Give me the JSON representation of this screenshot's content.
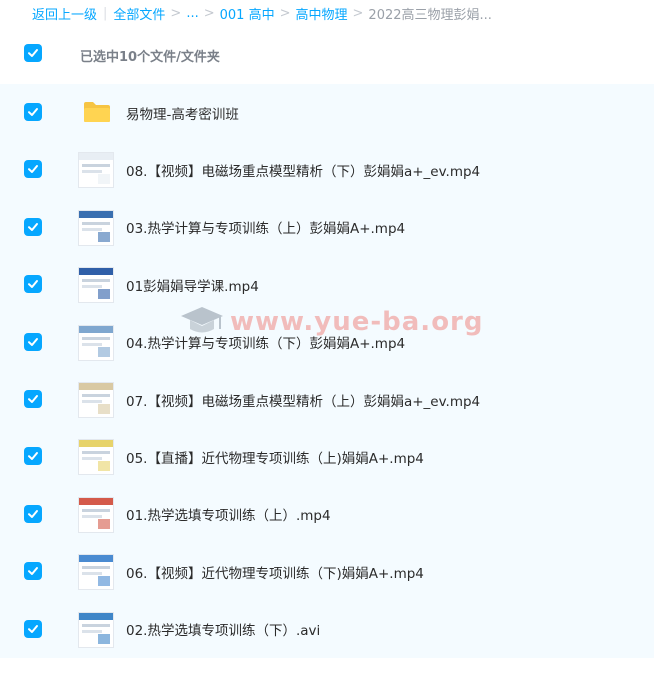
{
  "breadcrumb": {
    "back": "返回上一级",
    "items": [
      "全部文件",
      "...",
      "001 高中",
      "高中物理",
      "2022高三物理彭娟..."
    ]
  },
  "selection": {
    "label": "已选中10个文件/文件夹"
  },
  "files": [
    {
      "name": "易物理-高考密训班",
      "icon": "folder-icon",
      "accent": "#f6c443"
    },
    {
      "name": "08.【视频】电磁场重点模型精析（下）彭娟娟a+_ev.mp4",
      "icon": "video-thumbnail",
      "accent": "#e8eef4"
    },
    {
      "name": "03.热学计算与专项训练（上）彭娟娟A+.mp4",
      "icon": "video-thumbnail",
      "accent": "#3a6fb0"
    },
    {
      "name": "01彭娟娟导学课.mp4",
      "icon": "video-thumbnail",
      "accent": "#2f5fa8"
    },
    {
      "name": "04.热学计算与专项训练（下）彭娟娟A+.mp4",
      "icon": "video-thumbnail",
      "accent": "#7fa7cf"
    },
    {
      "name": "07.【视频】电磁场重点模型精析（上）彭娟娟a+_ev.mp4",
      "icon": "video-thumbnail",
      "accent": "#d9c9a3"
    },
    {
      "name": "05.【直播】近代物理专项训练（上)娟娟A+.mp4",
      "icon": "video-thumbnail",
      "accent": "#e7d36a"
    },
    {
      "name": "01.热学选填专项训练（上）.mp4",
      "icon": "video-thumbnail",
      "accent": "#d45a4a"
    },
    {
      "name": "06.【视频】近代物理专项训练（下)娟娟A+.mp4",
      "icon": "video-thumbnail",
      "accent": "#4a8bd1"
    },
    {
      "name": "02.热学选填专项训练（下）.avi",
      "icon": "video-thumbnail",
      "accent": "#3f86c8"
    }
  ],
  "watermark": {
    "text": "www.yue-ba.org",
    "icon": "graduation-cap-icon"
  },
  "colors": {
    "accent": "#06a7ff",
    "list_background": "#f4fbff"
  }
}
